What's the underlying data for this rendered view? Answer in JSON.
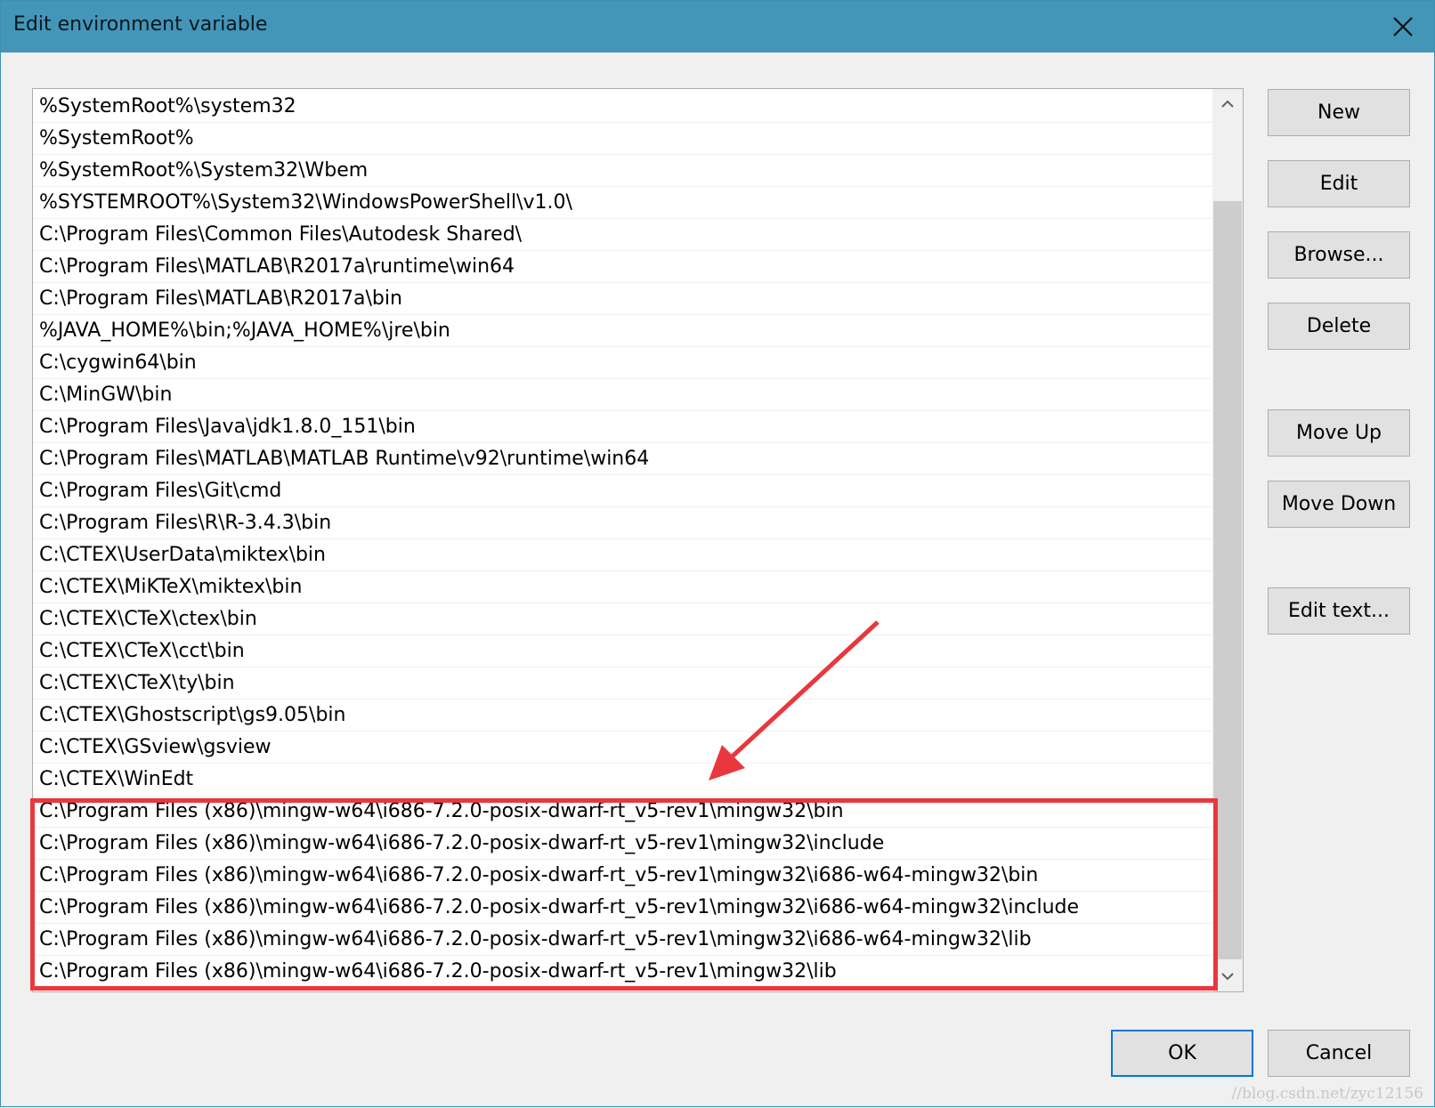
{
  "window": {
    "title": "Edit environment variable",
    "close_icon": "close-icon"
  },
  "list": {
    "items": [
      "%SystemRoot%\\system32",
      "%SystemRoot%",
      "%SystemRoot%\\System32\\Wbem",
      "%SYSTEMROOT%\\System32\\WindowsPowerShell\\v1.0\\",
      "C:\\Program Files\\Common Files\\Autodesk Shared\\",
      "C:\\Program Files\\MATLAB\\R2017a\\runtime\\win64",
      "C:\\Program Files\\MATLAB\\R2017a\\bin",
      "%JAVA_HOME%\\bin;%JAVA_HOME%\\jre\\bin",
      "C:\\cygwin64\\bin",
      "C:\\MinGW\\bin",
      "C:\\Program Files\\Java\\jdk1.8.0_151\\bin",
      "C:\\Program Files\\MATLAB\\MATLAB Runtime\\v92\\runtime\\win64",
      "C:\\Program Files\\Git\\cmd",
      "C:\\Program Files\\R\\R-3.4.3\\bin",
      "C:\\CTEX\\UserData\\miktex\\bin",
      "C:\\CTEX\\MiKTeX\\miktex\\bin",
      "C:\\CTEX\\CTeX\\ctex\\bin",
      "C:\\CTEX\\CTeX\\cct\\bin",
      "C:\\CTEX\\CTeX\\ty\\bin",
      "C:\\CTEX\\Ghostscript\\gs9.05\\bin",
      "C:\\CTEX\\GSview\\gsview",
      "C:\\CTEX\\WinEdt",
      "C:\\Program Files (x86)\\mingw-w64\\i686-7.2.0-posix-dwarf-rt_v5-rev1\\mingw32\\bin",
      "C:\\Program Files (x86)\\mingw-w64\\i686-7.2.0-posix-dwarf-rt_v5-rev1\\mingw32\\include",
      "C:\\Program Files (x86)\\mingw-w64\\i686-7.2.0-posix-dwarf-rt_v5-rev1\\mingw32\\i686-w64-mingw32\\bin",
      "C:\\Program Files (x86)\\mingw-w64\\i686-7.2.0-posix-dwarf-rt_v5-rev1\\mingw32\\i686-w64-mingw32\\include",
      "C:\\Program Files (x86)\\mingw-w64\\i686-7.2.0-posix-dwarf-rt_v5-rev1\\mingw32\\i686-w64-mingw32\\lib",
      "C:\\Program Files (x86)\\mingw-w64\\i686-7.2.0-posix-dwarf-rt_v5-rev1\\mingw32\\lib"
    ]
  },
  "buttons": {
    "new": "New",
    "edit": "Edit",
    "browse": "Browse...",
    "delete": "Delete",
    "move_up": "Move Up",
    "move_down": "Move Down",
    "edit_text": "Edit text...",
    "ok": "OK",
    "cancel": "Cancel"
  },
  "annotation": {
    "color": "#e8383d"
  },
  "watermark": "//blog.csdn.net/zyc12156"
}
